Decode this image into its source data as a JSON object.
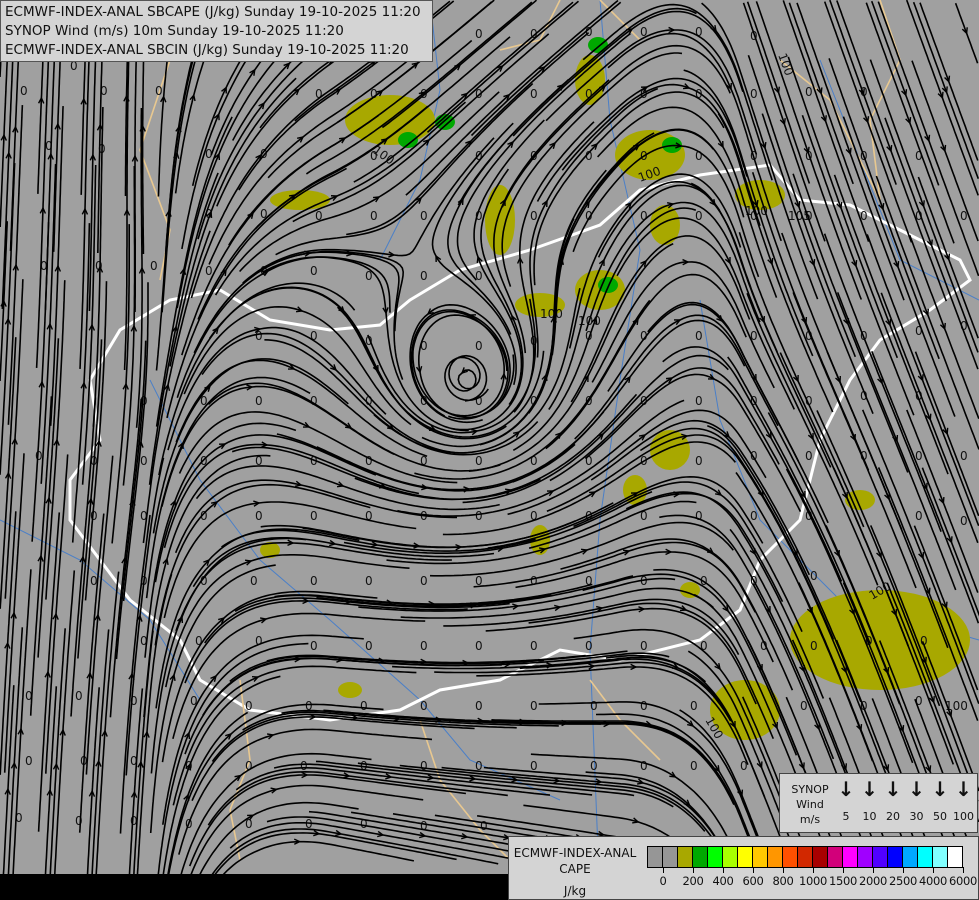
{
  "header": {
    "lines": [
      "ECMWF-INDEX-ANAL SBCAPE (J/kg) Sunday 19-10-2025 11:20",
      "SYNOP Wind (m/s) 10m Sunday 19-10-2025 11:20",
      "ECMWF-INDEX-ANAL SBCIN (J/kg) Sunday 19-10-2025 11:20"
    ]
  },
  "map": {
    "background_color": "#a0a0a0",
    "cape_fill_color": "#a8a800",
    "cape_high_color": "#00a800",
    "border_color": "#ffffff",
    "neighbour_border_color": "#e8c890",
    "river_color": "#4a7fc8",
    "streamline_color": "#000000",
    "contour_labels": [
      "0",
      "100",
      "105"
    ]
  },
  "wind_legend": {
    "title_lines": [
      "SYNOP",
      "Wind",
      "m/s"
    ],
    "icon": "wind-arrow-down-icon",
    "values": [
      "5",
      "10",
      "20",
      "30",
      "50",
      "100"
    ]
  },
  "cape_legend": {
    "title_lines": [
      "ECMWF-INDEX-ANAL",
      "CAPE",
      "J/kg"
    ],
    "colors": [
      "#969696",
      "#969696",
      "#a8a800",
      "#00a800",
      "#00ff00",
      "#a8ff00",
      "#ffff00",
      "#ffc800",
      "#ff9600",
      "#ff5000",
      "#d22800",
      "#a80000",
      "#d2007a",
      "#ff00ff",
      "#a000ff",
      "#5000ff",
      "#0000ff",
      "#00a8ff",
      "#00ffff",
      "#80ffff",
      "#ffffff"
    ],
    "ticks": [
      "0",
      "200",
      "400",
      "600",
      "800",
      "1000",
      "1500",
      "2000",
      "2500",
      "4000",
      "6000"
    ]
  }
}
